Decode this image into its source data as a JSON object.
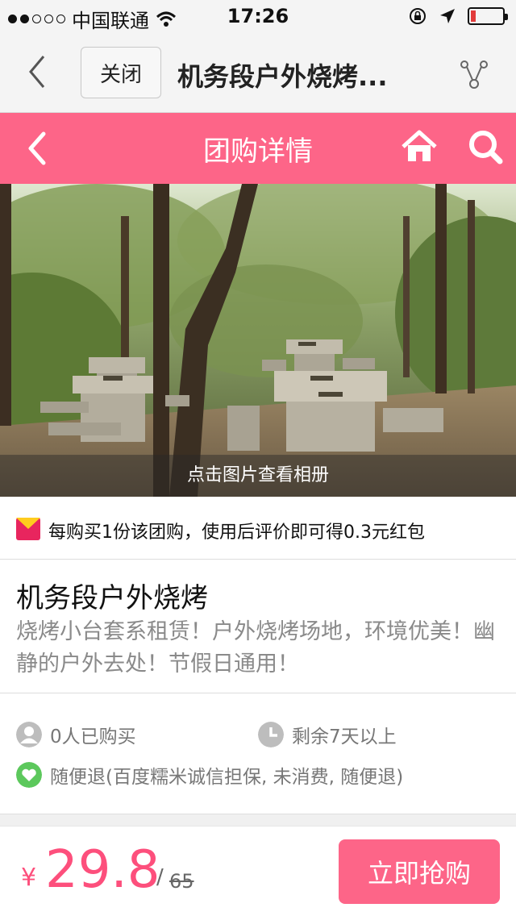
{
  "status_bar": {
    "carrier": "中国联通",
    "time": "17:26",
    "signal_bars_filled": 2,
    "signal_bars_total": 5,
    "battery_level": 0.15
  },
  "browser_bar": {
    "close_label": "关闭",
    "title": "机务段户外烧烤..."
  },
  "nav_bar": {
    "title": "团购详情",
    "icons": [
      "back-icon",
      "home-icon",
      "search-icon"
    ],
    "color": "#fd6588"
  },
  "hero": {
    "caption": "点击图片查看相册"
  },
  "promo": {
    "text": "每购买1份该团购，使用后评价即可得0.3元红包"
  },
  "product": {
    "title": "机务段户外烧烤",
    "description": "烧烤小台套系租赁！户外烧烤场地，环境优美！幽静的户外去处！节假日通用！"
  },
  "info": {
    "bought": "0人已购买",
    "remaining": "剩余7天以上",
    "refund": "随便退(百度糯米诚信担保, 未消费, 随便退)"
  },
  "buy_bar": {
    "currency": "¥",
    "price": "29.8",
    "separator": "/",
    "original_price": "65",
    "buy_label": "立即抢购",
    "accent": "#fd4f7c"
  }
}
